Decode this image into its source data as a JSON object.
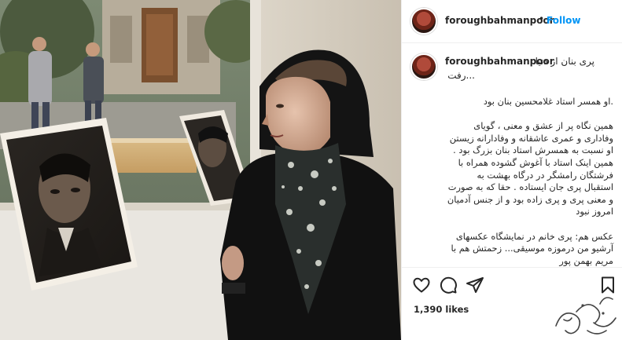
{
  "post": {
    "username": "foroughbahmanpoor",
    "follow_label": "Follow",
    "separator": "•"
  },
  "caption": {
    "title_line_1": "پری بنان از دنیا",
    "title_line_2": "...رفت",
    "paragraphs": [
      ".او همسر استاد غلامحسین بنان بود",
      "همین نگاه پر از عشق و معنی ، گویای وفاداری و عمری عاشقانه و وفادارانه زیستن او نسبت به همسرش استاد بنان بزرگ بود . همین اینک استاد با آغوش گشوده همراه با فرشتگان رامشگر در درگاه بهشت به استقبال پری جان ایستاده . حقا که به صورت و معنی پری و پری زاده بود و از جنس آدمیان امروز نبود",
      "عکس هم: پری خانم در نمایشگاه عکسهای آرشیو من درموزه موسیقی... زحمتش هم با مریم بهمن پور"
    ]
  },
  "actions": {
    "like_icon": "heart-icon",
    "comment_icon": "comment-icon",
    "share_icon": "share-icon",
    "save_icon": "bookmark-icon",
    "likes_text": "1,390 likes"
  },
  "photo": {
    "description_icon": "post-photo"
  },
  "colors": {
    "accent": "#0095f6",
    "text": "#262626",
    "border": "#efefef"
  }
}
